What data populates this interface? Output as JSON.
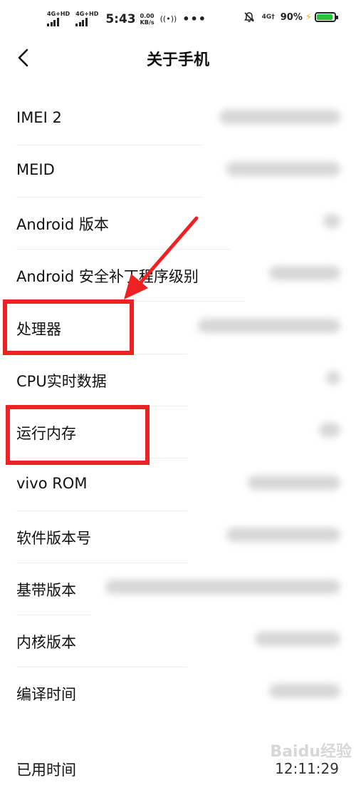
{
  "status_bar": {
    "sim1_label": "4G+HD",
    "sim2_label": "4G+HD",
    "time": "5:43",
    "speed_value": "0.00",
    "speed_unit": "KB/s",
    "hotspot_symbol": "((•))",
    "more": "•••",
    "network": "4G†",
    "battery_percent": "90%",
    "battery_level": 0.9,
    "icons": [
      "signal-bars-icon",
      "hotspot-icon",
      "bell-muted-icon",
      "charging-bolt-icon",
      "battery-icon"
    ]
  },
  "header": {
    "back_icon": "chevron-left-icon",
    "title": "关于手机"
  },
  "rows": [
    {
      "label": "IMEI 2"
    },
    {
      "label": "MEID"
    },
    {
      "label": "Android 版本"
    },
    {
      "label": "Android 安全补丁程序级别"
    },
    {
      "label": "处理器"
    },
    {
      "label": "CPU实时数据"
    },
    {
      "label": "运行内存"
    },
    {
      "label": "vivo ROM"
    },
    {
      "label": "软件版本号"
    },
    {
      "label": "基带版本"
    },
    {
      "label": "内核版本"
    },
    {
      "label": "编译时间"
    },
    {
      "label": "已用时间"
    }
  ],
  "footer": {
    "uptime_value": "12:11:29",
    "watermark_text": "Baidu经验"
  },
  "colors": {
    "annotation_red": "#ee2222",
    "battery_green": "#27c43a",
    "bolt_yellow": "#f0b400"
  }
}
